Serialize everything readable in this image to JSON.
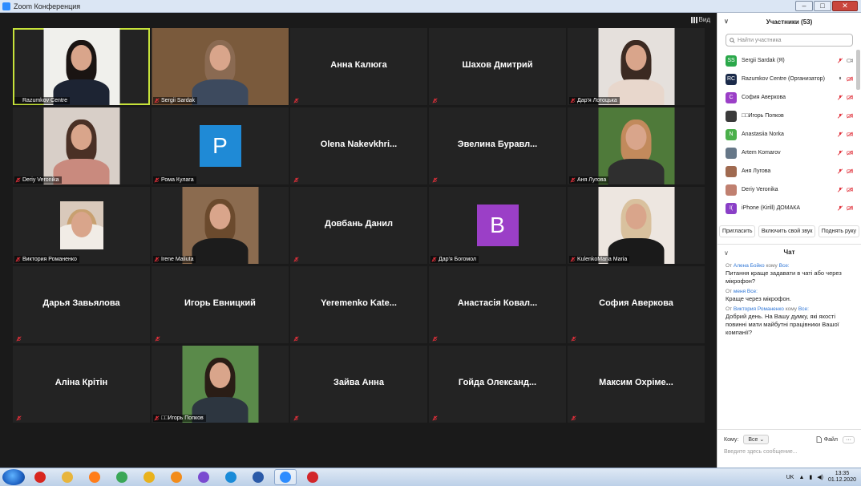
{
  "window": {
    "title": "Zoom Конференция"
  },
  "view_button": {
    "label": "Вид"
  },
  "tiles": [
    {
      "kind": "photo",
      "label": "Razumkov Centre",
      "active": true,
      "bg": "#f0f0ec",
      "hair": "#1a1412",
      "body": "#1d2433"
    },
    {
      "kind": "photo",
      "label": "Sergii Sardak",
      "wide": true,
      "bg": "#7a5a3c",
      "hair": "#8a6a52",
      "body": "#3d4a5e"
    },
    {
      "kind": "name",
      "label": "Анна Калюга"
    },
    {
      "kind": "name",
      "label": "Шахов Дмитрий"
    },
    {
      "kind": "photo",
      "label": "Дар'я Лотоцька",
      "bg": "#e5e0dc",
      "hair": "#3b2a22",
      "body": "#e8d7cc"
    },
    {
      "kind": "photo",
      "label": "Deriy Veronika",
      "bg": "#d8cfc8",
      "hair": "#4a3025",
      "body": "#c98a7e"
    },
    {
      "kind": "avatar",
      "label": "Рома Кулага",
      "letter": "P",
      "color": "#1f8ad6"
    },
    {
      "kind": "name",
      "label": "Olena Nakevkhri..."
    },
    {
      "kind": "name",
      "label": "Эвелина Буравл..."
    },
    {
      "kind": "photo",
      "label": "Аня Лугова",
      "bg": "#4f7a3a",
      "hair": "#c28a5c",
      "body": "#2f2f2f"
    },
    {
      "kind": "photo",
      "label": "Виктория Романенко",
      "small": true,
      "bg": "#d9c9bb",
      "hair": "#c8a070",
      "body": "#f1ece6"
    },
    {
      "kind": "photo",
      "label": "Irene Maliuta",
      "bg": "#8b6b4f",
      "hair": "#6b4a2d",
      "body": "#1c1c1c"
    },
    {
      "kind": "name",
      "label": "Довбань Данил"
    },
    {
      "kind": "avatar",
      "label": "Дар'я Богомол",
      "letter": "B",
      "color": "#9b3fc7"
    },
    {
      "kind": "photo",
      "label": "KulenkoMaria Maria",
      "bg": "#ede6e0",
      "hair": "#d9c19e",
      "body": "#1a1a1a"
    },
    {
      "kind": "name",
      "label": "Дарья Завьялова"
    },
    {
      "kind": "name",
      "label": "Игорь Евницкий"
    },
    {
      "kind": "name",
      "label": "Yeremenko Kate..."
    },
    {
      "kind": "name",
      "label": "Анастасія Ковал..."
    },
    {
      "kind": "name",
      "label": "София Аверкова"
    },
    {
      "kind": "name",
      "label": "Аліна Крітін"
    },
    {
      "kind": "photo",
      "label": "□□Игорь Попков",
      "bg": "#5a8a4a",
      "hair": "#2a1d16",
      "body": "#2d3640"
    },
    {
      "kind": "name",
      "label": "Зайва Анна"
    },
    {
      "kind": "name",
      "label": "Гойда Олександ..."
    },
    {
      "kind": "name",
      "label": "Максим Охріме..."
    }
  ],
  "participants": {
    "title": "Участники (53)",
    "search_placeholder": "Найти участника",
    "items": [
      {
        "name": "Sergii Sardak (Я)",
        "avatar": "SS",
        "color": "#2aa84a",
        "mic_on": false
      },
      {
        "name": "Razumkov Centre (Организатор)",
        "avatar": "RC",
        "color": "#1b2b4a",
        "mic_on": true
      },
      {
        "name": "София Аверкова",
        "avatar": "С",
        "color": "#9b3fc7",
        "mic_on": false
      },
      {
        "name": "□□Игорь Попков",
        "avatar": "",
        "color": "#3a3a3a",
        "mic_on": false
      },
      {
        "name": "Anastasiia Norka",
        "avatar": "N",
        "color": "#4bb04b",
        "mic_on": false
      },
      {
        "name": "Artem Komarov",
        "avatar": "",
        "color": "#667788",
        "mic_on": false
      },
      {
        "name": "Аня Лугова",
        "avatar": "",
        "color": "#a06a50",
        "mic_on": false
      },
      {
        "name": "Deriy Veronika",
        "avatar": "",
        "color": "#c08070",
        "mic_on": false
      },
      {
        "name": "iPhone (Kirill) ДОМАКА",
        "avatar": "I(",
        "color": "#8a3fc7",
        "mic_on": false
      }
    ],
    "buttons": {
      "invite": "Пригласить",
      "unmute": "Включить свой звук",
      "raise": "Поднять руку"
    }
  },
  "chat": {
    "title": "Чат",
    "messages": [
      {
        "from_prefix": "От",
        "from": "Алена Бойко",
        "to_prefix": "кому",
        "to": "Все:",
        "text": "Питання краще задавати в чаті або через мікрофон?"
      },
      {
        "from_prefix": "От",
        "from": "меня",
        "to_prefix": "",
        "to": "Все:",
        "text": "Краще через мікрофон."
      },
      {
        "from_prefix": "От",
        "from": "Виктория Романенко",
        "to_prefix": "кому",
        "to": "Все:",
        "text": "Добрий день. На Вашу думку, які якості повинні мати майбутні працівники Вашої компанії?"
      }
    ],
    "to_label": "Кому:",
    "to_value": "Все",
    "file_label": "Файл",
    "more_label": "···",
    "input_placeholder": "Введите здесь сообщение..."
  },
  "taskbar": {
    "apps": [
      {
        "name": "opera",
        "color": "#d8261f"
      },
      {
        "name": "file-explorer",
        "color": "#e8b53c"
      },
      {
        "name": "firefox",
        "color": "#ff7d1a"
      },
      {
        "name": "chrome",
        "color": "#3aa757"
      },
      {
        "name": "chrome-canary",
        "color": "#e9b21d"
      },
      {
        "name": "media-player",
        "color": "#f28c1b"
      },
      {
        "name": "viber",
        "color": "#7a4ad0"
      },
      {
        "name": "edge",
        "color": "#1a8bd8"
      },
      {
        "name": "word",
        "color": "#2b5aa8"
      },
      {
        "name": "zoom",
        "color": "#2d8cff"
      },
      {
        "name": "acrobat",
        "color": "#d2262a"
      }
    ],
    "lang": "UK",
    "time": "13:35",
    "date": "01.12.2020"
  }
}
